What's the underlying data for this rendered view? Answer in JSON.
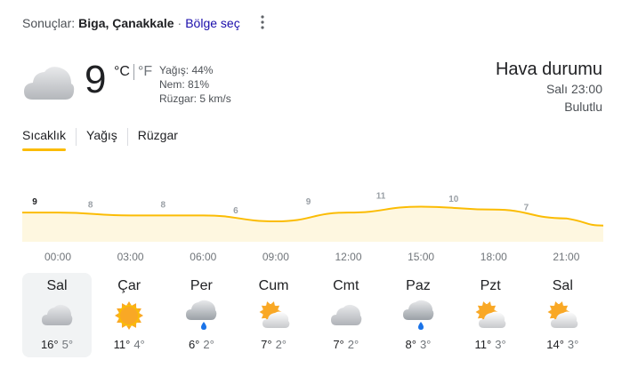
{
  "location_bar": {
    "prefix": "Sonuçlar:",
    "place": "Biga, Çanakkale",
    "separator": "·",
    "region_link": "Bölge seç"
  },
  "current": {
    "temperature": "9",
    "unit_c": "°C",
    "unit_f": "°F",
    "precipitation": "Yağış: 44%",
    "humidity": "Nem: 81%",
    "wind": "Rüzgar: 5 km/s",
    "icon": "cloudy-icon"
  },
  "header": {
    "title": "Hava durumu",
    "time": "Salı 23:00",
    "condition": "Bulutlu"
  },
  "tabs": [
    {
      "label": "Sıcaklık",
      "active": true
    },
    {
      "label": "Yağış",
      "active": false
    },
    {
      "label": "Rüzgar",
      "active": false
    }
  ],
  "chart_data": {
    "type": "area",
    "x": [
      "00:00",
      "03:00",
      "06:00",
      "09:00",
      "12:00",
      "15:00",
      "18:00",
      "21:00"
    ],
    "values": [
      9,
      8,
      8,
      6,
      9,
      11,
      10,
      7
    ],
    "line_color": "#fbbc04",
    "fill_color": "#fef7e0",
    "grid": false,
    "legend": "none"
  },
  "days": [
    {
      "name": "Sal",
      "high": "16°",
      "low": "5°",
      "icon": "cloudy-icon",
      "selected": true
    },
    {
      "name": "Çar",
      "high": "11°",
      "low": "4°",
      "icon": "sunny-icon",
      "selected": false
    },
    {
      "name": "Per",
      "high": "6°",
      "low": "2°",
      "icon": "rain-icon",
      "selected": false
    },
    {
      "name": "Cum",
      "high": "7°",
      "low": "2°",
      "icon": "partly-cloudy-icon",
      "selected": false
    },
    {
      "name": "Cmt",
      "high": "7°",
      "low": "2°",
      "icon": "cloudy-icon",
      "selected": false
    },
    {
      "name": "Paz",
      "high": "8°",
      "low": "3°",
      "icon": "rain-icon",
      "selected": false
    },
    {
      "name": "Pzt",
      "high": "11°",
      "low": "3°",
      "icon": "partly-cloudy-icon",
      "selected": false
    },
    {
      "name": "Sal",
      "high": "14°",
      "low": "3°",
      "icon": "partly-cloudy-icon",
      "selected": false
    }
  ]
}
